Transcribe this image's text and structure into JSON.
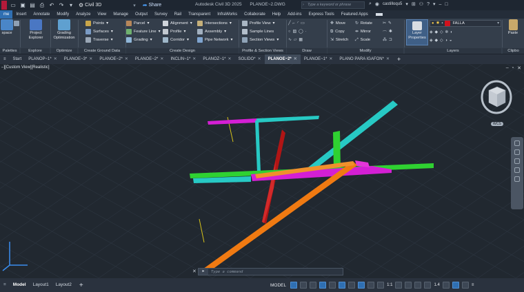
{
  "titlebar": {
    "workspace": "Civil 3D",
    "share": "Share",
    "product": "Autodesk Civil 3D 2025",
    "filename": "PLANOE~2.DWG",
    "search_placeholder": "Type a keyword or phrase",
    "user": "castilloqu5"
  },
  "ribbon_tabs": [
    "me",
    "Insert",
    "Annotate",
    "Modify",
    "Analyze",
    "View",
    "Manage",
    "Output",
    "Survey",
    "Rail",
    "Transparent",
    "InfraWorks",
    "Collaborate",
    "Help",
    "Add-ins",
    "Express Tools",
    "Featured Apps"
  ],
  "ribbon": {
    "palettes": {
      "big_label": "space",
      "label": "Palettes"
    },
    "explore": {
      "btn": "Project Explorer",
      "label": "Explore"
    },
    "optimize": {
      "btn": "Grading Optimization",
      "label": "Optimize"
    },
    "ground": {
      "items": [
        "Points",
        "Surfaces",
        "Traverse"
      ],
      "label": "Create Ground Data"
    },
    "design": {
      "col1": [
        "Parcel",
        "Feature Line",
        "Grading"
      ],
      "col2": [
        "Alignment",
        "Profile",
        "Corridor"
      ],
      "col3": [
        "Intersections",
        "Assembly",
        "Pipe Network"
      ],
      "label": "Create Design"
    },
    "views": {
      "items": [
        "Profile View",
        "Sample Lines",
        "Section Views"
      ],
      "label": "Profile & Section Views"
    },
    "draw": {
      "label": "Draw"
    },
    "modify": {
      "col1": [
        "Move",
        "Copy",
        "Stretch"
      ],
      "col2": [
        "Rotate",
        "Mirror",
        "Scale"
      ],
      "label": "Modify"
    },
    "layers": {
      "btn": "Layer Properties",
      "current_layer": "FALLA",
      "label": "Layers"
    },
    "clipboard": {
      "btn": "Paste",
      "label": "Clipbo"
    }
  },
  "doc_tabs": [
    {
      "label": "Start",
      "active": false
    },
    {
      "label": "PLANOP~1*",
      "active": false
    },
    {
      "label": "PLANOE~3*",
      "active": false
    },
    {
      "label": "PLANOE~2*",
      "active": false
    },
    {
      "label": "PLANOE~2*",
      "active": false
    },
    {
      "label": "INCLIN~1*",
      "active": false
    },
    {
      "label": "PLANOZ~1*",
      "active": false
    },
    {
      "label": "SOLIDO*",
      "active": false
    },
    {
      "label": "PLANOE~2*",
      "active": true
    },
    {
      "label": "PLANOE~1*",
      "active": false
    },
    {
      "label": "PLANO PARA IGAFON*",
      "active": false
    }
  ],
  "viewport": {
    "label": "–][Custom View][Realistic]",
    "wcs": "WCS",
    "command_placeholder": "Type a command"
  },
  "status": {
    "layouts": [
      "Model",
      "Layout1",
      "Layout2"
    ],
    "model_label": "MODEL",
    "scale": "1:1",
    "scale2": "1.4"
  },
  "colors": {
    "magenta": "#d41fd4",
    "cyan": "#27c9c4",
    "green": "#2fd131",
    "orange": "#f07a12",
    "red": "#c11a1a",
    "yellow": "#d6c21a",
    "accent": "#2f6fb2"
  }
}
